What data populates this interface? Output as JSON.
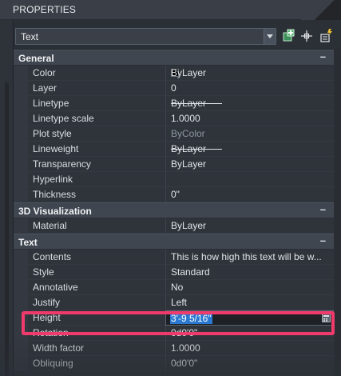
{
  "panel": {
    "title": "PROPERTIES"
  },
  "toolbar": {
    "selection": "Text",
    "icons": [
      "add-to-selection-icon",
      "select-objects-icon",
      "quick-select-icon"
    ]
  },
  "sections": {
    "general": {
      "label": "General",
      "collapse": "–",
      "rows": [
        {
          "name": "Color",
          "value": "ByLayer"
        },
        {
          "name": "Layer",
          "value": "0"
        },
        {
          "name": "Linetype",
          "value": "ByLayer"
        },
        {
          "name": "Linetype scale",
          "value": "1.0000"
        },
        {
          "name": "Plot style",
          "value": "ByColor"
        },
        {
          "name": "Lineweight",
          "value": "ByLayer"
        },
        {
          "name": "Transparency",
          "value": "ByLayer"
        },
        {
          "name": "Hyperlink",
          "value": ""
        },
        {
          "name": "Thickness",
          "value": "0\""
        }
      ]
    },
    "visualization": {
      "label": "3D Visualization",
      "collapse": "–",
      "rows": [
        {
          "name": "Material",
          "value": "ByLayer"
        }
      ]
    },
    "text": {
      "label": "Text",
      "collapse": "–",
      "rows": [
        {
          "name": "Contents",
          "value": "This is how high this text will be w..."
        },
        {
          "name": "Style",
          "value": "Standard"
        },
        {
          "name": "Annotative",
          "value": "No"
        },
        {
          "name": "Justify",
          "value": "Left"
        },
        {
          "name": "Height",
          "value": "3'-9 5/16\""
        },
        {
          "name": "Rotation",
          "value": "0d0'0\""
        },
        {
          "name": "Width factor",
          "value": "1.0000"
        },
        {
          "name": "Obliquing",
          "value": "0d0'0\""
        }
      ]
    }
  },
  "colors": {
    "highlight": "#ef3a6b",
    "selection": "#2b78d0",
    "color_swatch": "#000000"
  }
}
